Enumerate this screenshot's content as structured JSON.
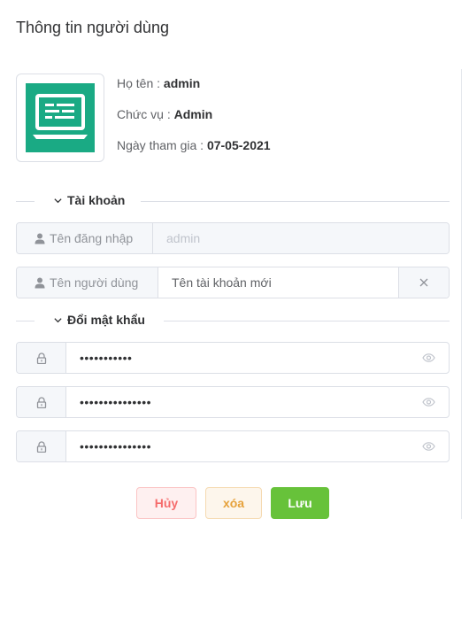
{
  "page": {
    "title": "Thông tin người dùng"
  },
  "profile": {
    "name_label": "Họ tên : ",
    "name_value": "admin",
    "role_label": "Chức vụ : ",
    "role_value": "Admin",
    "joined_label": "Ngày tham gia : ",
    "joined_value": "07-05-2021",
    "avatar_icon": "laptop-icon",
    "avatar_color": "#1aaa84"
  },
  "account_section": {
    "title": "Tài khoản",
    "username_label": "Tên đăng nhập",
    "username_placeholder": "admin",
    "displayname_label": "Tên người dùng",
    "displayname_value": "Tên tài khoản mới"
  },
  "password_section": {
    "title": "Đổi mật khẩu",
    "current_password": "•••••••••••",
    "new_password": "•••••••••••••••",
    "confirm_password": "•••••••••••••••"
  },
  "actions": {
    "cancel_label": "Hủy",
    "delete_label": "xóa",
    "save_label": "Lưu"
  },
  "colors": {
    "cancel": "#f56c6c",
    "delete": "#e6a23c",
    "save": "#67c23a"
  }
}
